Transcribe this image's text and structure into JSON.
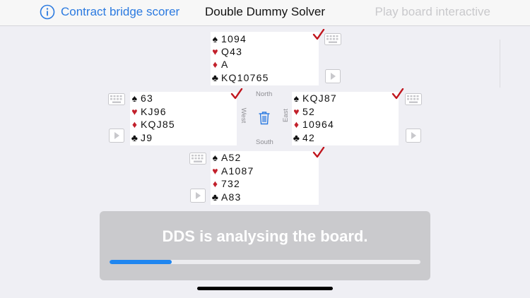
{
  "nav": {
    "scorer_label": "Contract bridge scorer",
    "title": "Double Dummy Solver",
    "play_label": "Play board interactive"
  },
  "hands": {
    "north": {
      "spades": "1094",
      "hearts": "Q43",
      "diamonds": "A",
      "clubs": "KQ10765"
    },
    "west": {
      "spades": "63",
      "hearts": "KJ96",
      "diamonds": "KQJ85",
      "clubs": "J9"
    },
    "east": {
      "spades": "KQJ87",
      "hearts": "52",
      "diamonds": "10964",
      "clubs": "42"
    },
    "south": {
      "spades": "A52",
      "hearts": "A1087",
      "diamonds": "732",
      "clubs": "A83"
    }
  },
  "compass": {
    "north": "North",
    "south": "South",
    "west": "West",
    "east": "East"
  },
  "suits": {
    "spades": "♠",
    "hearts": "♥",
    "diamonds": "♦",
    "clubs": "♣"
  },
  "status": {
    "message": "DDS is analysing the board.",
    "progress": 0.2
  },
  "colors": {
    "accent": "#2b7ae0",
    "progress": "#1f86f0",
    "red_suit": "#c2202b",
    "check": "#c0141c"
  },
  "icons": {
    "info": "info-icon",
    "check": "checkmark-icon",
    "keyboard": "keyboard-icon",
    "play": "play-icon",
    "trash": "trash-icon"
  }
}
